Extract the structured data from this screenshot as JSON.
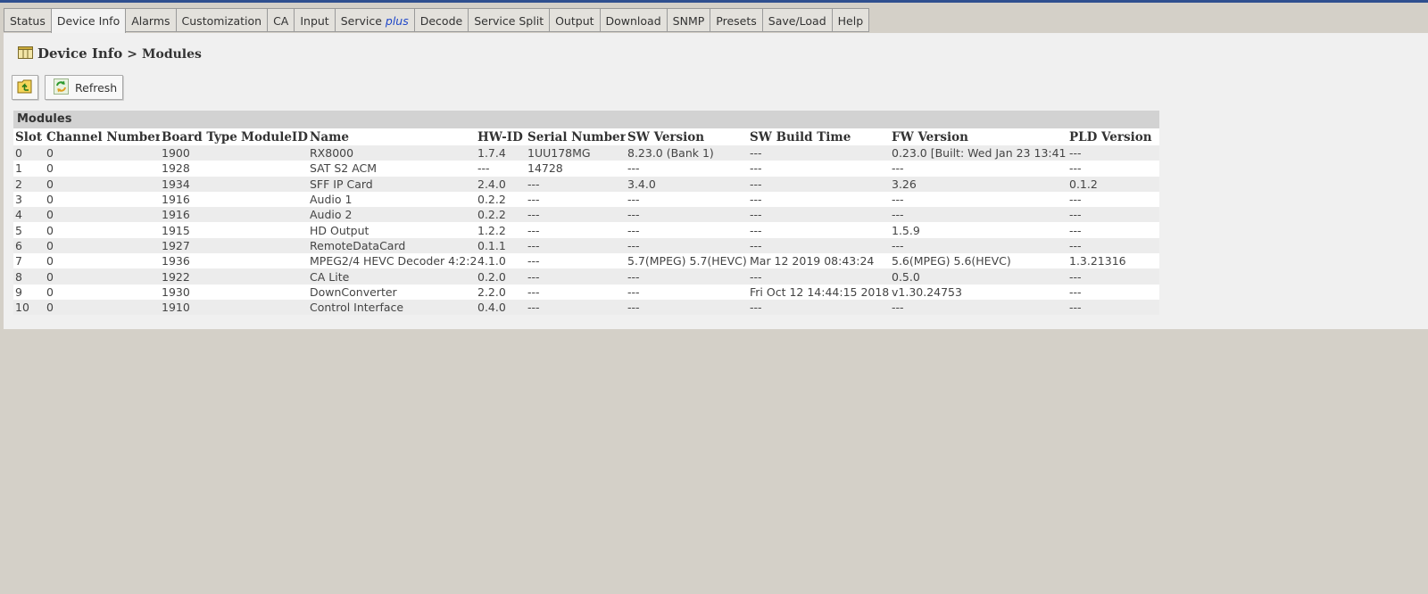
{
  "tabs": [
    {
      "label": "Status"
    },
    {
      "label": "Device Info",
      "active": true
    },
    {
      "label": "Alarms"
    },
    {
      "label": "Customization"
    },
    {
      "label": "CA"
    },
    {
      "label": "Input"
    },
    {
      "label": "Service ",
      "suffix": "plus"
    },
    {
      "label": "Decode"
    },
    {
      "label": "Service Split"
    },
    {
      "label": "Output"
    },
    {
      "label": "Download"
    },
    {
      "label": "SNMP"
    },
    {
      "label": "Presets"
    },
    {
      "label": "Save/Load"
    },
    {
      "label": "Help"
    }
  ],
  "breadcrumb": {
    "icon": "table-icon",
    "root": "Device Info",
    "separator": ">",
    "page": "Modules"
  },
  "toolbar": {
    "up_icon": "folder-up-icon",
    "refresh_icon": "refresh-icon",
    "refresh_label": "Refresh"
  },
  "panel": {
    "title": "Modules",
    "columns": [
      "Slot",
      "Channel Number",
      "Board Type",
      "ModuleID",
      "Name",
      "HW-ID",
      "Serial Number",
      "SW Version",
      "SW Build Time",
      "FW Version",
      "PLD Version"
    ],
    "rows": [
      [
        "0",
        "0",
        "1900",
        "",
        "RX8000",
        "1.7.4",
        "1UU178MG",
        "8.23.0 (Bank 1)",
        "---",
        "0.23.0 [Built: Wed Jan 23 13:41",
        "---"
      ],
      [
        "1",
        "0",
        "1928",
        "",
        "SAT S2 ACM",
        "---",
        "14728",
        "---",
        "---",
        "---",
        "---"
      ],
      [
        "2",
        "0",
        "1934",
        "",
        "SFF IP Card",
        "2.4.0",
        "---",
        "3.4.0",
        "---",
        "3.26",
        "0.1.2"
      ],
      [
        "3",
        "0",
        "1916",
        "",
        "Audio 1",
        "0.2.2",
        "---",
        "---",
        "---",
        "---",
        "---"
      ],
      [
        "4",
        "0",
        "1916",
        "",
        "Audio 2",
        "0.2.2",
        "---",
        "---",
        "---",
        "---",
        "---"
      ],
      [
        "5",
        "0",
        "1915",
        "",
        "HD Output",
        "1.2.2",
        "---",
        "---",
        "---",
        "1.5.9",
        "---"
      ],
      [
        "6",
        "0",
        "1927",
        "",
        "RemoteDataCard",
        "0.1.1",
        "---",
        "---",
        "---",
        "---",
        "---"
      ],
      [
        "7",
        "0",
        "1936",
        "",
        "MPEG2/4 HEVC Decoder 4:2:2",
        "4.1.0",
        "---",
        "5.7(MPEG) 5.7(HEVC)",
        "Mar 12 2019 08:43:24",
        "5.6(MPEG) 5.6(HEVC)",
        "1.3.21316"
      ],
      [
        "8",
        "0",
        "1922",
        "",
        "CA Lite",
        "0.2.0",
        "---",
        "---",
        "---",
        "0.5.0",
        "---"
      ],
      [
        "9",
        "0",
        "1930",
        "",
        "DownConverter",
        "2.2.0",
        "---",
        "---",
        "Fri Oct 12 14:44:15 2018",
        "v1.30.24753",
        "---"
      ],
      [
        "10",
        "0",
        "1910",
        "",
        "Control Interface",
        "0.4.0",
        "---",
        "---",
        "---",
        "---",
        "---"
      ]
    ]
  },
  "colors": {
    "top_bar": "#2f4f8f",
    "background": "#d4d0c8",
    "content": "#f0f0f0",
    "tab_plus": "#1e46c8"
  }
}
